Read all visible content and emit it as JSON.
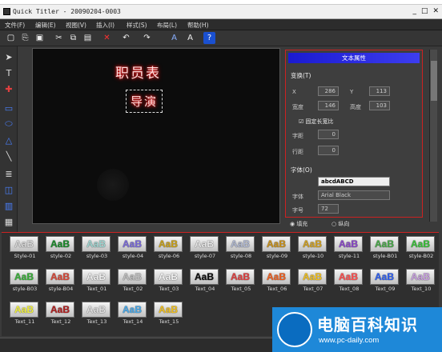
{
  "window": {
    "title": "Quick Titler - 20090204-0003",
    "controls": [
      "_",
      "□",
      "✕"
    ]
  },
  "menu": [
    "文件(F)",
    "编辑(E)",
    "视图(V)",
    "插入(I)",
    "样式(S)",
    "布局(L)",
    "帮助(H)"
  ],
  "toolbar": {
    "icons": [
      "new-icon",
      "open-icon",
      "save-icon",
      "cut-icon",
      "copy-icon",
      "paste-icon",
      "delete-icon",
      "undo-icon",
      "redo-icon",
      "text-style-icon",
      "text-edit-icon",
      "help-icon"
    ]
  },
  "tools": [
    "select-tool",
    "text-tool",
    "crop-tool",
    "rect-tool",
    "ellipse-tool",
    "triangle-tool",
    "line-tool",
    "align-tool",
    "arrange-tool",
    "layer-tool",
    "grid-tool"
  ],
  "canvas": {
    "text1": "职员表",
    "text2": "导演"
  },
  "properties": {
    "header": "文本属性",
    "transform_title": "变换(T)",
    "x_label": "X",
    "x_value": "286",
    "y_label": "Y",
    "y_value": "113",
    "width_label": "宽度",
    "width_value": "146",
    "height_label": "高度",
    "height_value": "103",
    "lock_aspect": "固定长宽比",
    "char_spacing_label": "字距",
    "char_spacing_value": "0",
    "line_spacing_label": "行距",
    "line_spacing_value": "0",
    "font_title": "字体(O)",
    "font_preview": "abcdABCD",
    "font_label": "字体",
    "font_value": "Arial Black",
    "size_label": "字号",
    "size_value": "72",
    "radio1": "填充",
    "radio2": "纵向"
  },
  "styles": {
    "preview_text": "AaB",
    "items": [
      {
        "name": "Style-01",
        "color": "#d8d8d8"
      },
      {
        "name": "style-02",
        "color": "#1a8a2a"
      },
      {
        "name": "style-03",
        "color": "#9fd4d0"
      },
      {
        "name": "style-04",
        "color": "#7a6ad8"
      },
      {
        "name": "style-06",
        "color": "#c8a018"
      },
      {
        "name": "style-07",
        "color": "#e8e8e8"
      },
      {
        "name": "style-08",
        "color": "#b0b8d0"
      },
      {
        "name": "style-09",
        "color": "#c89018"
      },
      {
        "name": "style-10",
        "color": "#d0a020"
      },
      {
        "name": "style-11",
        "color": "#8a48c8"
      },
      {
        "name": "style-B01",
        "color": "#48a848"
      },
      {
        "name": "style-B02",
        "color": "#38c038"
      },
      {
        "name": "style-B03",
        "color": "#38b038"
      },
      {
        "name": "style-B04",
        "color": "#d84838"
      },
      {
        "name": "Text_01",
        "color": "#f0f0f0"
      },
      {
        "name": "Text_02",
        "color": "#c0c0c0"
      },
      {
        "name": "Text_03",
        "color": "#f4f4f4"
      },
      {
        "name": "Text_04",
        "color": "#101010"
      },
      {
        "name": "Text_05",
        "color": "#e04040"
      },
      {
        "name": "Text_06",
        "color": "#f06020"
      },
      {
        "name": "Text_07",
        "color": "#f0c020"
      },
      {
        "name": "Text_08",
        "color": "#ff5050"
      },
      {
        "name": "Text_09",
        "color": "#3060f0"
      },
      {
        "name": "Text_10",
        "color": "#c8a0e0"
      },
      {
        "name": "Text_11",
        "color": "#f0f040"
      },
      {
        "name": "Text_12",
        "color": "#b02020"
      },
      {
        "name": "Text_13",
        "color": "#e0e0e0"
      },
      {
        "name": "Text_14",
        "color": "#48a8e8"
      },
      {
        "name": "Text_15",
        "color": "#f0c020"
      }
    ]
  },
  "watermark": {
    "cn": "电脑百科知识",
    "url": "www.pc-daily.com"
  }
}
